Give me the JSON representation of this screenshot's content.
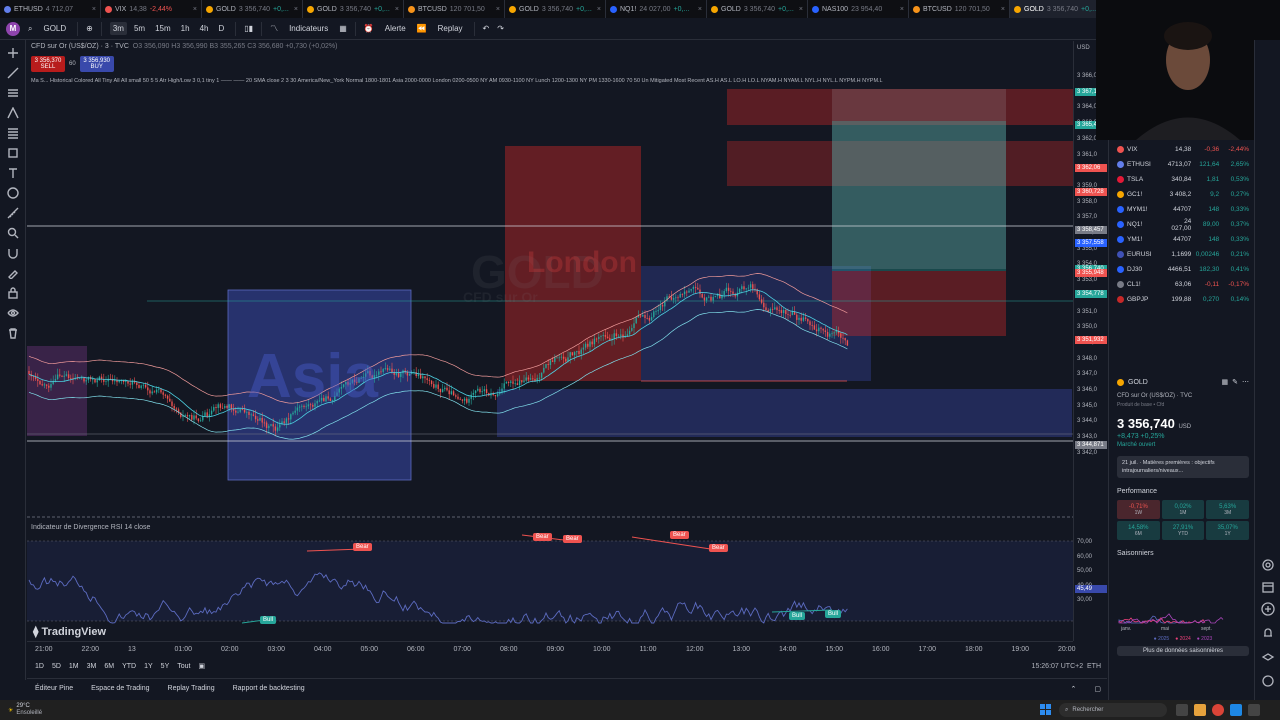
{
  "browser_tabs": [
    {
      "symbol": "ETHUSD",
      "price": "4 712,07",
      "change": "",
      "dot": "#627eea",
      "active": false
    },
    {
      "symbol": "VIX",
      "price": "14,38",
      "change": "-2,44%",
      "dot": "#ef5350",
      "neg": true,
      "active": false
    },
    {
      "symbol": "GOLD",
      "price": "3 356,740",
      "change": "+0,...",
      "dot": "#f7a600",
      "active": false
    },
    {
      "symbol": "GOLD",
      "price": "3 356,740",
      "change": "+0,...",
      "dot": "#f7a600",
      "active": false
    },
    {
      "symbol": "BTCUSD",
      "price": "120 701,50",
      "change": "",
      "dot": "#f7931a",
      "active": false
    },
    {
      "symbol": "GOLD",
      "price": "3 356,740",
      "change": "+0,...",
      "dot": "#f7a600",
      "active": false
    },
    {
      "symbol": "NQ1!",
      "price": "24 027,00",
      "change": "+0,...",
      "dot": "#2962ff",
      "active": false
    },
    {
      "symbol": "GOLD",
      "price": "3 356,740",
      "change": "+0,...",
      "dot": "#f7a600",
      "active": false
    },
    {
      "symbol": "NAS100",
      "price": "23 954,40",
      "change": "",
      "dot": "#2962ff",
      "active": false
    },
    {
      "symbol": "BTCUSD",
      "price": "120 701,50",
      "change": "",
      "dot": "#f7931a",
      "active": false
    },
    {
      "symbol": "GOLD",
      "price": "3 356,740",
      "change": "+0,...",
      "dot": "#f7a600",
      "active": true
    }
  ],
  "toolbar": {
    "avatar": "M",
    "symbol": "GOLD",
    "intervals": [
      "3m",
      "5m",
      "15m",
      "1h",
      "4h",
      "D"
    ],
    "active_interval": "3m",
    "indicators_label": "Indicateurs",
    "alert_label": "Alerte",
    "replay_label": "Replay"
  },
  "chart": {
    "title_line": "CFD sur Or (US$/OZ) · 3 · TVC",
    "ohlc_line": "O3 356,090 H3 356,990 B3 355,265 C3 356,680 +0,730 (+0,02%)",
    "sell_price": "3 356,370",
    "sell_label": "SELL",
    "spread": "60",
    "buy_price": "3 356,930",
    "buy_label": "BUY",
    "indicator_line": "Ma S... Historical Colored All Tiny All All small 50 5 5 Atr High/Low 3 0,1 tiny 1 —— —— 20 SMA close 2 3 30 America/New_York Normal 1800-1801 Asia 2000-0000 London 0200-0500 NY AM 0930-1100 NY Lunch 1200-1300 NY PM 1330-1600 70 50 Un Mitigated Most Recent AS.H AS.L LO.H LO.L NYAM.H NYAM.L NYL.H NYL.L NYPM.H NYPM.L",
    "watermark_sym": "GOLD",
    "watermark_name": "CFD sur Or",
    "asia_label": "Asia",
    "london_label": "London",
    "rsi_title": "Indicateur de Divergence RSI 14 close",
    "tv_brand": "TradingView",
    "signals": [
      {
        "type": "bear",
        "label": "Bear"
      },
      {
        "type": "bear",
        "label": "Bear"
      },
      {
        "type": "bear",
        "label": "Bear"
      },
      {
        "type": "bear",
        "label": "Bear"
      },
      {
        "type": "bear",
        "label": "Bear"
      },
      {
        "type": "bull",
        "label": "Bull"
      },
      {
        "type": "bull",
        "label": "Bull"
      },
      {
        "type": "bull",
        "label": "Bull"
      }
    ]
  },
  "price_axis": {
    "currency": "USD",
    "labels": [
      "3 366,0",
      "3 365,0",
      "3 364,0",
      "3 363,0",
      "3 362,0",
      "3 361,0",
      "3 360,0",
      "3 359,0",
      "3 358,0",
      "3 357,0",
      "3 356,0",
      "3 355,0",
      "3 354,0",
      "3 353,0",
      "3 352,0",
      "3 351,0",
      "3 350,0",
      "3 349,0",
      "3 348,0",
      "3 347,0",
      "3 346,0",
      "3 345,0",
      "3 344,0",
      "3 343,0",
      "3 342,0"
    ],
    "tags": [
      {
        "text": "3 367,1",
        "color": "#26a69a"
      },
      {
        "text": "3 365,4",
        "color": "#26a69a"
      },
      {
        "text": "3 362,06",
        "color": "#ef5350"
      },
      {
        "text": "3 360,728",
        "color": "#ef5350"
      },
      {
        "text": "3 358,457",
        "color": "#787b86"
      },
      {
        "text": "3 357,558",
        "color": "#2962ff"
      },
      {
        "text": "3 356,740",
        "color": "#26a69a"
      },
      {
        "text": "3 355,948",
        "color": "#ef5350"
      },
      {
        "text": "3 354,778",
        "color": "#26a69a"
      },
      {
        "text": "3 351,932",
        "color": "#ef5350"
      },
      {
        "text": "3 344,871",
        "color": "#787b86"
      }
    ],
    "rsi_labels": [
      "70,00",
      "60,00",
      "50,00",
      "40,00",
      "30,00"
    ],
    "rsi_tag": "45,49"
  },
  "time_axis": [
    "21:00",
    "22:00",
    "13",
    "01:00",
    "02:00",
    "03:00",
    "04:00",
    "05:00",
    "06:00",
    "07:00",
    "08:00",
    "09:00",
    "10:00",
    "11:00",
    "12:00",
    "13:00",
    "14:00",
    "15:00",
    "16:00",
    "17:00",
    "18:00",
    "19:00",
    "20:00"
  ],
  "range_bar": {
    "ranges": [
      "1D",
      "5D",
      "1M",
      "3M",
      "6M",
      "YTD",
      "1Y",
      "5Y",
      "Tout"
    ],
    "clock": "15:26:07 UTC+2",
    "session": "ETH"
  },
  "bottom_tabs": [
    "Éditeur Pine",
    "Espace de Trading",
    "Replay Trading",
    "Rapport de backtesting"
  ],
  "watchlist": [
    {
      "sym": "VIX",
      "last": "14,38",
      "chg": "-0,36",
      "pct": "-2,44%",
      "up": false,
      "dot": "#ef5350"
    },
    {
      "sym": "ETHUSI",
      "last": "4713,07",
      "chg": "121,64",
      "pct": "2,65%",
      "up": true,
      "dot": "#627eea"
    },
    {
      "sym": "TSLA",
      "last": "340,84",
      "chg": "1,81",
      "pct": "0,53%",
      "up": true,
      "dot": "#e31937"
    },
    {
      "sym": "GC1!",
      "last": "3 408,2",
      "chg": "9,2",
      "pct": "0,27%",
      "up": true,
      "dot": "#f7a600"
    },
    {
      "sym": "MYM1!",
      "last": "44707",
      "chg": "148",
      "pct": "0,33%",
      "up": true,
      "dot": "#2962ff"
    },
    {
      "sym": "NQ1!",
      "last": "24 027,00",
      "chg": "89,00",
      "pct": "0,37%",
      "up": true,
      "dot": "#2962ff"
    },
    {
      "sym": "YM1!",
      "last": "44707",
      "chg": "148",
      "pct": "0,33%",
      "up": true,
      "dot": "#2962ff"
    },
    {
      "sym": "EURUSI",
      "last": "1,1699",
      "chg": "0,00246",
      "pct": "0,21%",
      "up": true,
      "dot": "#3f51b5"
    },
    {
      "sym": "DJ30",
      "last": "4466,51",
      "chg": "182,30",
      "pct": "0,41%",
      "up": true,
      "dot": "#2962ff"
    },
    {
      "sym": "CL1!",
      "last": "63,06",
      "chg": "-0,11",
      "pct": "-0,17%",
      "up": false,
      "dot": "#787b86"
    },
    {
      "sym": "GBPJP",
      "last": "199,88",
      "chg": "0,270",
      "pct": "0,14%",
      "up": true,
      "dot": "#c62828"
    }
  ],
  "details": {
    "symbol": "GOLD",
    "full_name": "CFD sur Or (US$/OZ) · TVC",
    "sub": "Produit de base • Cfd",
    "price": "3 356,740",
    "currency": "USD",
    "change": "+8,473 +0,25%",
    "status": "Marché ouvert",
    "news": "21 juil. · Matières premières : objectifs intrajournaliers/niveaux...",
    "perf_title": "Performance",
    "perf": [
      {
        "v": "-0,71%",
        "l": "1W",
        "up": false
      },
      {
        "v": "0,02%",
        "l": "1M",
        "up": true
      },
      {
        "v": "5,63%",
        "l": "3M",
        "up": true
      },
      {
        "v": "14,58%",
        "l": "6M",
        "up": true
      },
      {
        "v": "27,91%",
        "l": "YTD",
        "up": true
      },
      {
        "v": "35,07%",
        "l": "1Y",
        "up": true
      }
    ],
    "seasonal_title": "Saisonniers",
    "seasonal_months": [
      "janv.",
      "mai",
      "sept."
    ],
    "seasonal_legend": [
      "2025",
      "2024",
      "2023"
    ],
    "seasonal_button": "Plus de données saisonnières"
  },
  "taskbar": {
    "temp": "29°C",
    "weather": "Ensoleillé",
    "search_placeholder": "Rechercher"
  },
  "colors": {
    "bull": "#26a69a",
    "bear": "#ef5350",
    "asia": "#3949ab",
    "london": "#c62828"
  }
}
